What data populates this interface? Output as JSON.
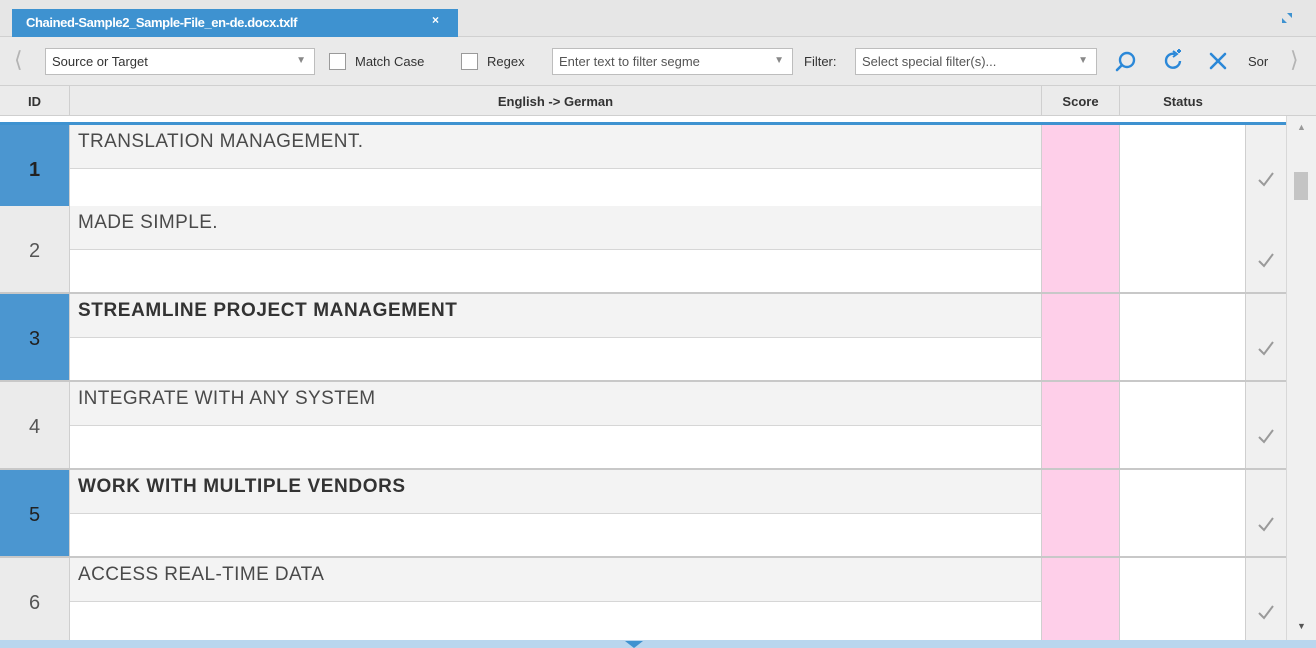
{
  "tab": {
    "title": "Chained-Sample2_Sample-File_en-de.docx.txlf",
    "close_glyph": "×"
  },
  "toolbar": {
    "scope_select": "Source or Target",
    "match_case_label": "Match Case",
    "match_case_checked": false,
    "regex_label": "Regex",
    "regex_checked": false,
    "filter_text_placeholder": "Enter text to filter segme",
    "filter_label": "Filter:",
    "special_filter_placeholder": "Select special filter(s)...",
    "sort_label": "Sor",
    "icons": [
      "chevron-left-icon",
      "search-icon",
      "refresh-add-icon",
      "clear-filter-icon",
      "chevron-right-icon"
    ]
  },
  "grid": {
    "columns": {
      "id": "ID",
      "text": "English -> German",
      "score": "Score",
      "status": "Status"
    },
    "rows": [
      {
        "id": "1",
        "source": "TRANSLATION MANAGEMENT.",
        "target": "",
        "bold": false,
        "selected": true,
        "active": true
      },
      {
        "id": "2",
        "source": "MADE SIMPLE.",
        "target": "",
        "bold": false,
        "selected": false,
        "active": false
      },
      {
        "id": "3",
        "source": "STREAMLINE PROJECT MANAGEMENT",
        "target": "",
        "bold": true,
        "selected": true,
        "active": false
      },
      {
        "id": "4",
        "source": "INTEGRATE WITH ANY SYSTEM",
        "target": "",
        "bold": false,
        "selected": false,
        "active": false
      },
      {
        "id": "5",
        "source": "WORK WITH MULTIPLE VENDORS",
        "target": "",
        "bold": true,
        "selected": true,
        "active": false
      },
      {
        "id": "6",
        "source": "ACCESS REAL-TIME DATA",
        "target": "",
        "bold": false,
        "selected": false,
        "active": false
      }
    ]
  },
  "colors": {
    "accent": "#3e92d0",
    "score_fill": "#fecfe9",
    "id_selected": "#4b96d0"
  }
}
